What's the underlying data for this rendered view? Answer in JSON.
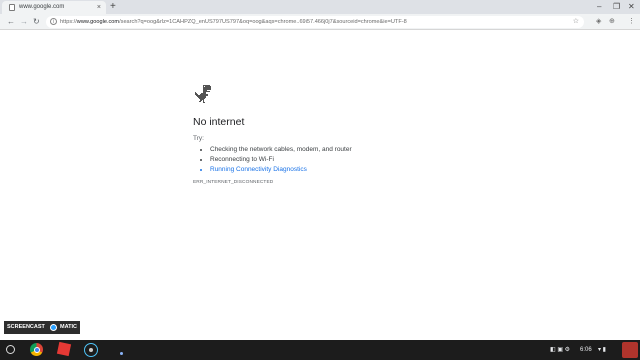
{
  "browser": {
    "tab_title": "www.google.com",
    "tab_close": "×",
    "new_tab": "+",
    "window_controls": {
      "minimize": "–",
      "restore": "❐",
      "close": "✕"
    },
    "nav": {
      "back": "←",
      "forward": "→",
      "reload": "↻"
    },
    "url": {
      "scheme": "https://",
      "host": "www.google.com",
      "rest": "/search?q=oog&rlz=1CAHPZQ_enUS797US797&oq=oog&aqs=chrome..69i57.466j0j7&sourceid=chrome&ie=UTF-8"
    },
    "omnibox_info": "i",
    "bookmark_star": "☆",
    "extension_icons": {
      "ext1": "◈",
      "ext2": "⊕",
      "menu": "⋮"
    }
  },
  "error_page": {
    "title": "No internet",
    "try_label": "Try:",
    "suggestions": [
      {
        "text": "Checking the network cables, modem, and router",
        "link": false
      },
      {
        "text": "Reconnecting to Wi-Fi",
        "link": false
      },
      {
        "text": "Running Connectivity Diagnostics",
        "link": true
      }
    ],
    "error_code": "ERR_INTERNET_DISCONNECTED"
  },
  "watermark": {
    "left": "SCREENCAST",
    "right": "MATIC"
  },
  "shelf": {
    "tray_icons": "◧ ▣ ⚙",
    "time": "6:06",
    "status_icons": "▾ ▮"
  },
  "colors": {
    "link": "#1a73e8",
    "shelf": "#1c1c1c",
    "tabbar": "#dee1e6"
  }
}
